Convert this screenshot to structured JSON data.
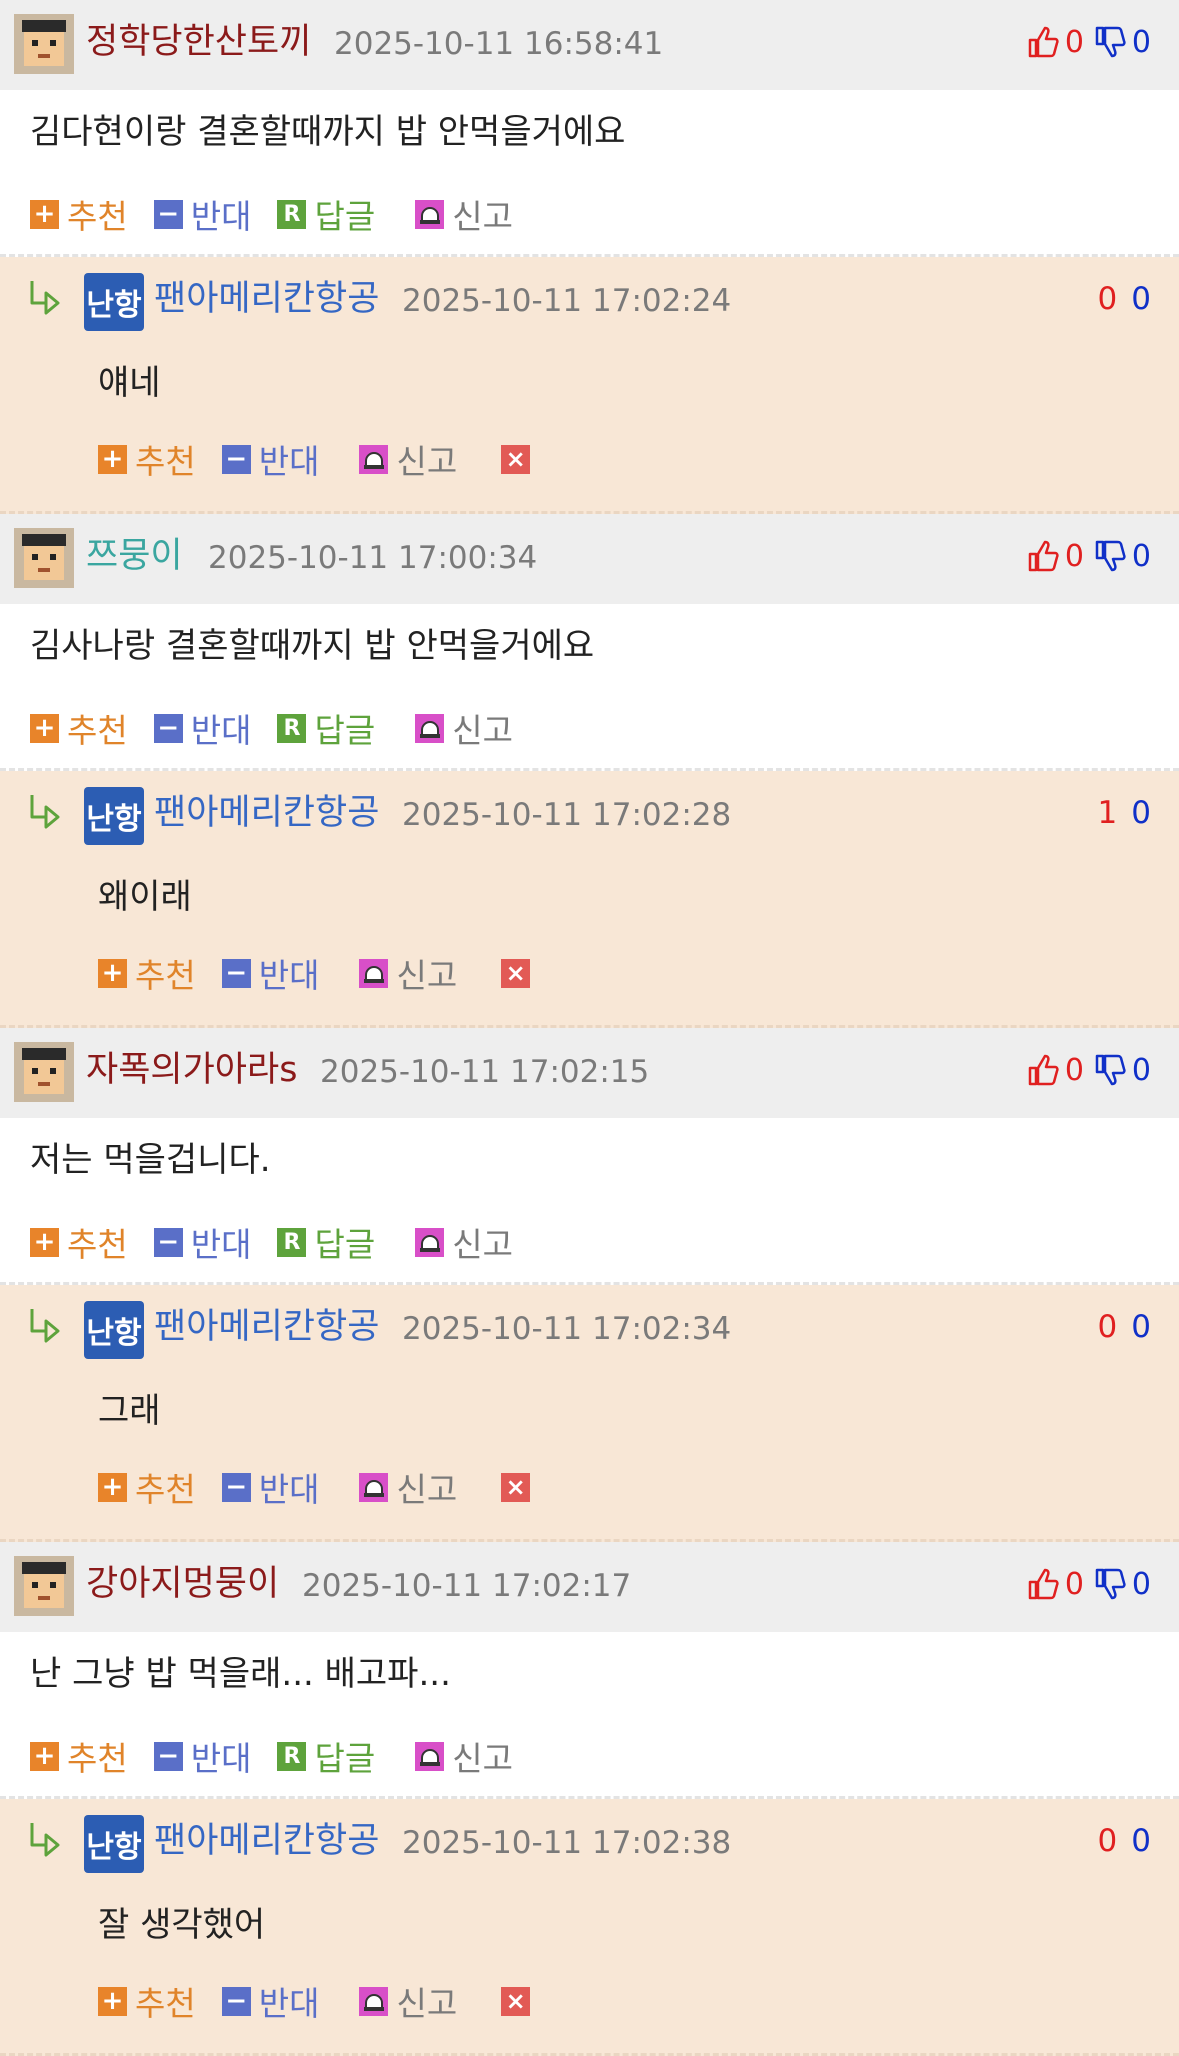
{
  "labels": {
    "recommend": "추천",
    "oppose": "반대",
    "reply": "답글",
    "report": "신고",
    "plus_glyph": "+",
    "minus_glyph": "−",
    "reply_glyph": "R",
    "delete_glyph": "×"
  },
  "colors": {
    "comment_header_bg": "#eeeeee",
    "reply_bg": "#f8e7d6",
    "up_color": "#e02020",
    "down_color": "#1030c8"
  },
  "comments": [
    {
      "nick": "정학당한산토끼",
      "nick_color": "#8b1a1a",
      "date": "2025-10-11 16:58:41",
      "up": "0",
      "down": "0",
      "text": "김다현이랑 결혼할때까지 밥 안먹을거에요",
      "avatar_icon": "pixel-character-avatar",
      "reply": {
        "nick": "팬아메리칸항공",
        "date": "2025-10-11 17:02:24",
        "up": "0",
        "down": "0",
        "text": "얘네",
        "avatar_text": "난항"
      }
    },
    {
      "nick": "쯔뭉이",
      "nick_color": "#3aa6a0",
      "date": "2025-10-11 17:00:34",
      "up": "0",
      "down": "0",
      "text": "김사나랑 결혼할때까지 밥 안먹을거에요",
      "avatar_icon": "photo-avatar",
      "reply": {
        "nick": "팬아메리칸항공",
        "date": "2025-10-11 17:02:28",
        "up": "1",
        "down": "0",
        "text": "왜이래",
        "avatar_text": "난항"
      }
    },
    {
      "nick": "자폭의가아라s",
      "nick_color": "#8b1a1a",
      "date": "2025-10-11 17:02:15",
      "up": "0",
      "down": "0",
      "text": "저는 먹을겁니다.",
      "avatar_icon": "sketch-avatar",
      "reply": {
        "nick": "팬아메리칸항공",
        "date": "2025-10-11 17:02:34",
        "up": "0",
        "down": "0",
        "text": "그래",
        "avatar_text": "난항"
      }
    },
    {
      "nick": "강아지멍뭉이",
      "nick_color": "#8b1a1a",
      "date": "2025-10-11 17:02:17",
      "up": "0",
      "down": "0",
      "text": "난 그냥 밥 먹을래... 배고파...",
      "avatar_icon": "dog-photo-avatar",
      "reply": {
        "nick": "팬아메리칸항공",
        "date": "2025-10-11 17:02:38",
        "up": "0",
        "down": "0",
        "text": "잘 생각했어",
        "avatar_text": "난항"
      }
    }
  ]
}
